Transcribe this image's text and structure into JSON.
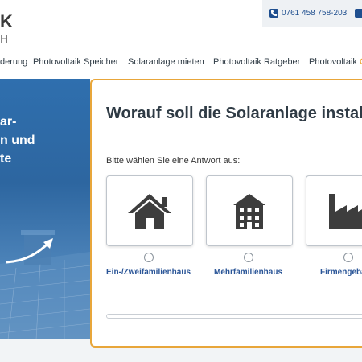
{
  "logo": {
    "line1": "K",
    "line2": "H"
  },
  "contact": {
    "phone": "0761 458 758-203",
    "phone_icon": "phone-icon",
    "second_icon": "contact-icon"
  },
  "nav": {
    "items": [
      {
        "label": "derung"
      },
      {
        "label": "Photovoltaik Speicher"
      },
      {
        "label": "Solaranlage mieten"
      },
      {
        "label": "Photovoltaik Ratgeber"
      },
      {
        "label": "Photovoltaik"
      }
    ],
    "accent_fragment": "C"
  },
  "hero": {
    "lines": [
      "ar-",
      "n und",
      "te"
    ]
  },
  "form": {
    "title": "Worauf soll die Solaranlage installie",
    "prompt": "Bitte wählen Sie eine Antwort aus:",
    "options": [
      {
        "label": "Ein-/Zweifamilienhaus",
        "icon": "house-icon"
      },
      {
        "label": "Mehrfamilienhaus",
        "icon": "apartment-building-icon"
      },
      {
        "label": "Firmengebä",
        "icon": "factory-icon"
      }
    ],
    "progress": 0,
    "colors": {
      "accent": "#e8a63a",
      "label": "#2a5597",
      "icon": "#3d3d3d"
    }
  }
}
